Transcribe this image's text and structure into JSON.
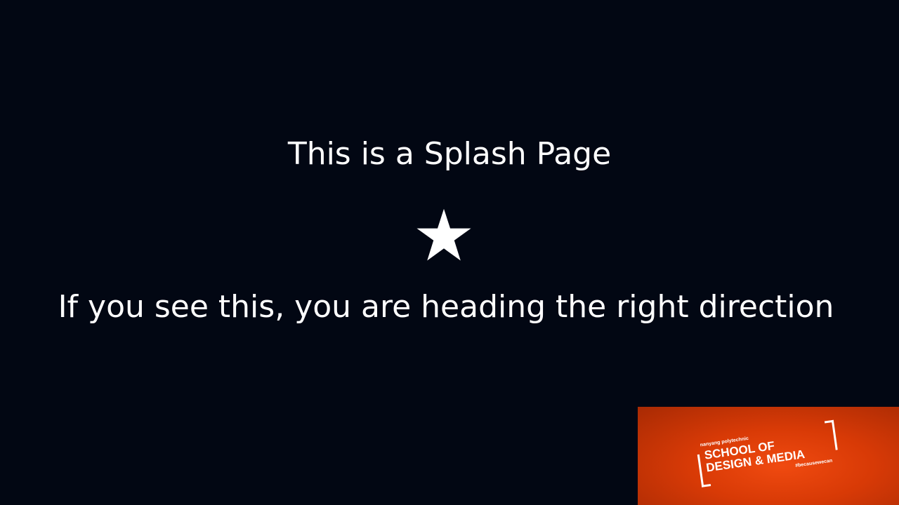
{
  "splash": {
    "title": "This is a Splash Page",
    "icon": "star-icon",
    "subtitle": "If you see this, you are heading the right direction"
  },
  "logo": {
    "small_text": "nanyang polytechnic",
    "line1": "SCHOOL OF",
    "line2": "DESIGN & MEDIA",
    "tag": "#becausewecan",
    "background_color": "#e8440c"
  },
  "colors": {
    "background": "#020713",
    "text": "#ffffff"
  }
}
